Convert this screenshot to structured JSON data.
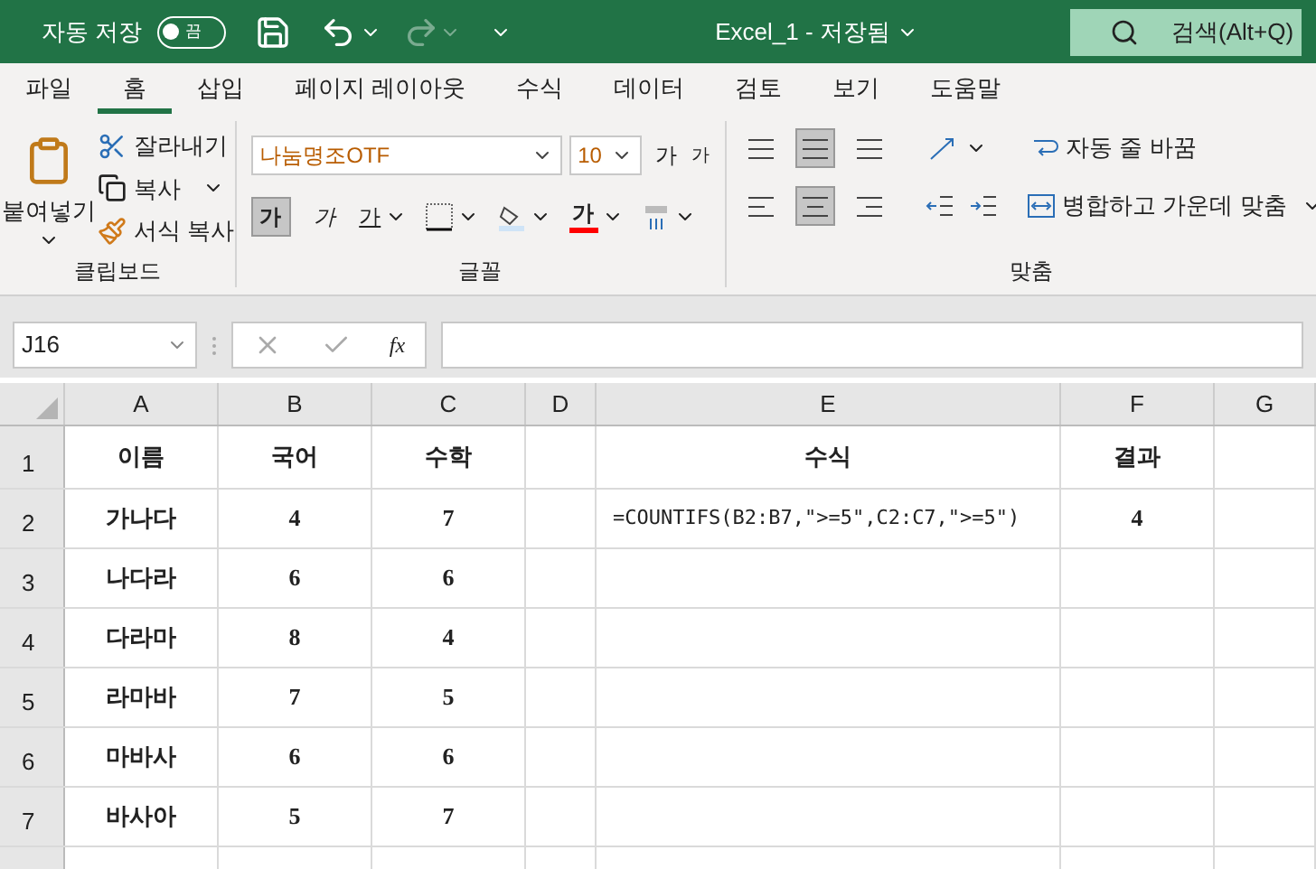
{
  "title_bar": {
    "autosave_label": "자동 저장",
    "autosave": {
      "on": false,
      "label": "끔"
    },
    "title": "Excel_1 - 저장됨",
    "search_placeholder": "검색(Alt+Q)"
  },
  "menu_tabs": [
    {
      "label": "파일",
      "selected": false
    },
    {
      "label": "홈",
      "selected": true
    },
    {
      "label": "삽입",
      "selected": false
    },
    {
      "label": "페이지 레이아웃",
      "selected": false
    },
    {
      "label": "수식",
      "selected": false
    },
    {
      "label": "데이터",
      "selected": false
    },
    {
      "label": "검토",
      "selected": false
    },
    {
      "label": "보기",
      "selected": false
    },
    {
      "label": "도움말",
      "selected": false
    }
  ],
  "ribbon": {
    "clipboard": {
      "paste": "붙여넣기",
      "cut": "잘라내기",
      "copy": "복사",
      "format_painter": "서식 복사",
      "label": "클립보드"
    },
    "font": {
      "font_name": "나눔명조OTF",
      "font_size": "10",
      "grow": "가",
      "shrink": "가",
      "bold": {
        "label": "가",
        "pressed": true
      },
      "italic": {
        "label": "가",
        "pressed": false
      },
      "underline": {
        "label": "가",
        "pressed": false
      },
      "font_color": {
        "label": "가",
        "color": "#ff0000"
      },
      "label": "글꼴"
    },
    "alignment": {
      "vertical": [
        {
          "selected": false
        },
        {
          "selected": true
        },
        {
          "selected": false
        }
      ],
      "horizontal": [
        {
          "selected": false
        },
        {
          "selected": true
        },
        {
          "selected": false
        }
      ],
      "wrap_text": "자동 줄 바꿈",
      "merge_center": "병합하고 가운데 맞춤",
      "label": "맞춤"
    }
  },
  "formula_bar": {
    "name_box": "J16",
    "fx": "fx"
  },
  "sheet": {
    "columns": [
      "A",
      "B",
      "C",
      "D",
      "E",
      "F",
      "G"
    ],
    "rows": [
      {
        "number": "1",
        "cells": {
          "A": "이름",
          "B": "국어",
          "C": "수학",
          "E": "수식",
          "F": "결과"
        }
      },
      {
        "number": "2",
        "cells": {
          "A": "가나다",
          "B": "4",
          "C": "7",
          "E": "=COUNTIFS(B2:B7,\">=5\",C2:C7,\">=5\")",
          "F": "4"
        }
      },
      {
        "number": "3",
        "cells": {
          "A": "나다라",
          "B": "6",
          "C": "6"
        }
      },
      {
        "number": "4",
        "cells": {
          "A": "다라마",
          "B": "8",
          "C": "4"
        }
      },
      {
        "number": "5",
        "cells": {
          "A": "라마바",
          "B": "7",
          "C": "5"
        }
      },
      {
        "number": "6",
        "cells": {
          "A": "마바사",
          "B": "6",
          "C": "6"
        }
      },
      {
        "number": "7",
        "cells": {
          "A": "바사아",
          "B": "5",
          "C": "7"
        }
      }
    ]
  }
}
